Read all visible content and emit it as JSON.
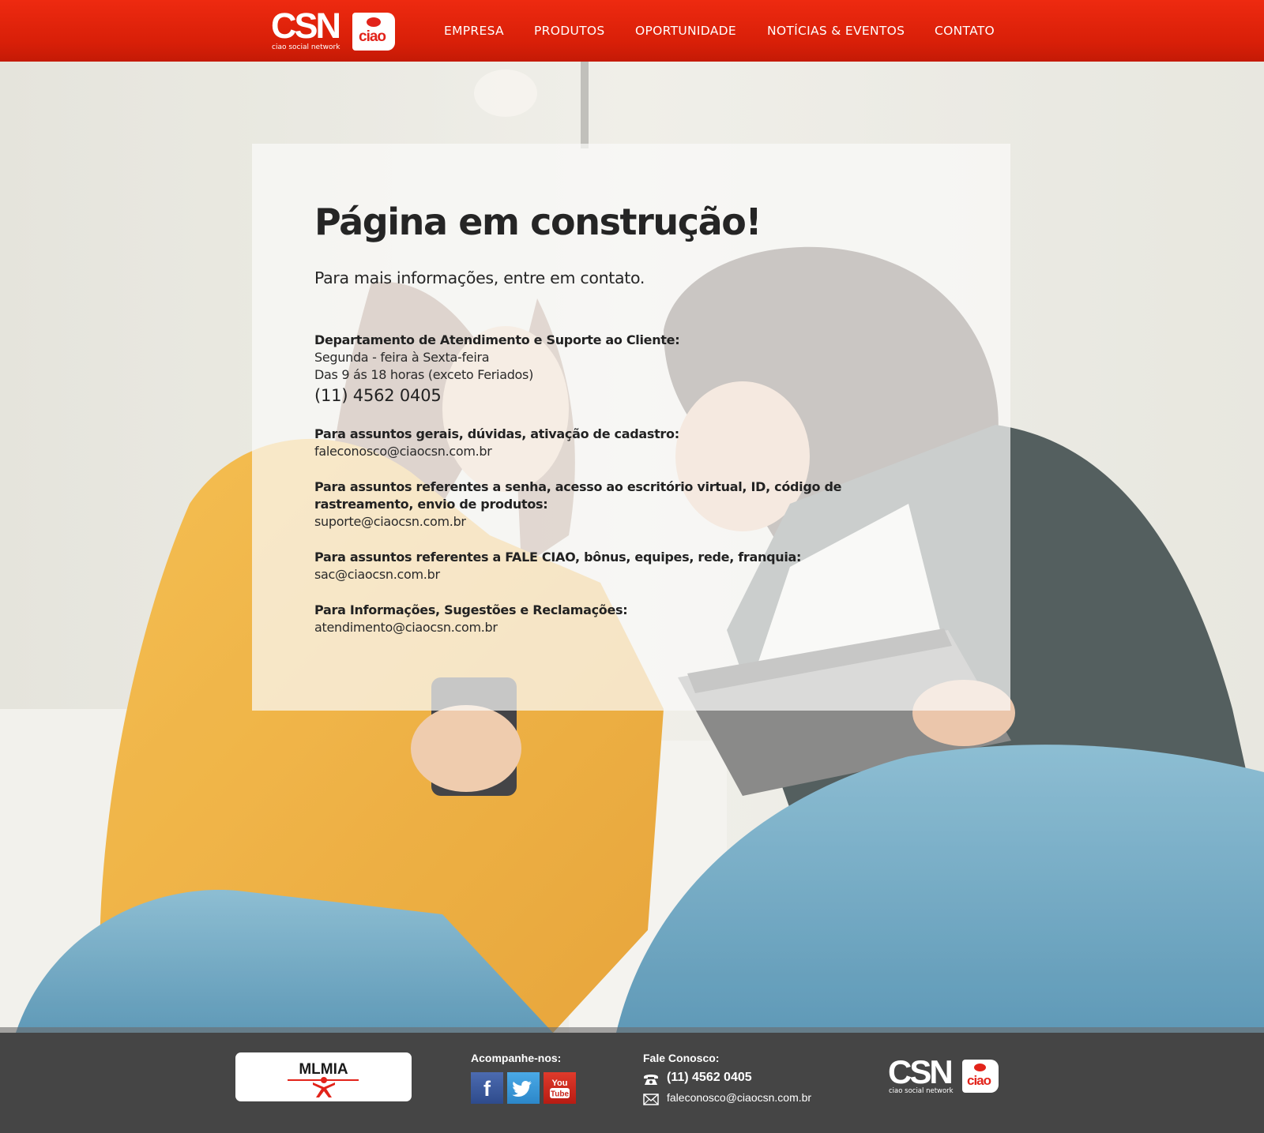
{
  "header": {
    "logo": {
      "main": "CSN",
      "badge": "ciao",
      "tagline": "ciao social network"
    },
    "nav": [
      {
        "label": "EMPRESA"
      },
      {
        "label": "PRODUTOS"
      },
      {
        "label": "OPORTUNIDADE"
      },
      {
        "label": "NOTÍCIAS & EVENTOS"
      },
      {
        "label": "CONTATO"
      }
    ]
  },
  "main": {
    "title": "Página em construção!",
    "subtitle": "Para mais informações, entre em contato.",
    "support": {
      "label": "Departamento de Atendimento e Suporte ao Cliente:",
      "days": "Segunda - feira à Sexta-feira",
      "hours": "Das 9 ás 18 horas (exceto Feriados)",
      "phone": "(11) 4562 0405"
    },
    "contacts": [
      {
        "label": "Para assuntos gerais, dúvidas, ativação de cadastro:",
        "email": "faleconosco@ciaocsn.com.br"
      },
      {
        "label": "Para assuntos referentes a senha, acesso ao escritório virtual, ID, código de rastreamento, envio de produtos:",
        "email": "suporte@ciaocsn.com.br"
      },
      {
        "label": "Para assuntos referentes a FALE CIAO, bônus, equipes, rede, franquia:",
        "email": "sac@ciaocsn.com.br"
      },
      {
        "label": "Para Informações, Sugestões e Reclamações:",
        "email": "atendimento@ciaocsn.com.br"
      }
    ]
  },
  "footer": {
    "partner_logo": "MLMIA",
    "follow_title": "Acompanhe-nos:",
    "social": [
      {
        "name": "facebook-icon",
        "glyph": "f"
      },
      {
        "name": "twitter-icon",
        "glyph": "bird"
      },
      {
        "name": "youtube-icon",
        "glyph": "You Tube"
      }
    ],
    "contact_title": "Fale Conosco:",
    "phone": "(11) 4562 0405",
    "email": "faleconosco@ciaocsn.com.br",
    "logo": {
      "main": "CSN",
      "badge": "ciao",
      "tagline": "ciao social network"
    }
  },
  "colors": {
    "brand_red": "#e2231a",
    "header_red": "#d81f08",
    "footer_gray": "#454545",
    "text_dark": "#252525"
  }
}
